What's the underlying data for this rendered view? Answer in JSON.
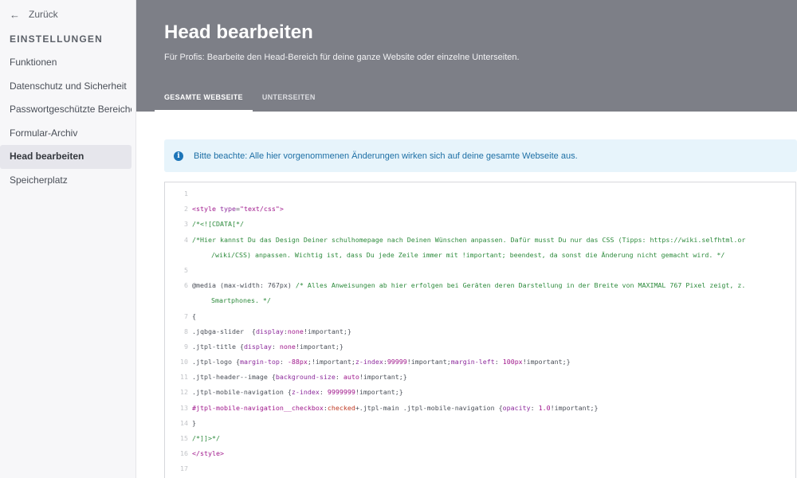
{
  "sidebar": {
    "back_label": "Zurück",
    "back_icon": "arrow-left-icon",
    "section_title": "EINSTELLUNGEN",
    "items": [
      {
        "label": "Funktionen",
        "active": false
      },
      {
        "label": "Datenschutz und Sicherheit",
        "active": false
      },
      {
        "label": "Passwortgeschützte Bereiche",
        "active": false
      },
      {
        "label": "Formular-Archiv",
        "active": false
      },
      {
        "label": "Head bearbeiten",
        "active": true
      },
      {
        "label": "Speicherplatz",
        "active": false
      }
    ]
  },
  "header": {
    "title": "Head bearbeiten",
    "subtitle": "Für Profis: Bearbeite den Head-Bereich für deine ganze Website oder einzelne Unterseiten.",
    "tabs": [
      {
        "label": "GESAMTE WEBSEITE",
        "active": true
      },
      {
        "label": "UNTERSEITEN",
        "active": false
      }
    ]
  },
  "notice": {
    "icon": "info-icon",
    "text": "Bitte beachte: Alle hier vorgenommenen Änderungen wirken sich auf deine gesamte Webseite aus."
  },
  "editor": {
    "lines": [
      {
        "n": "1",
        "tokens": []
      },
      {
        "n": "2",
        "tokens": [
          [
            "tag",
            "<style "
          ],
          [
            "prop",
            "type"
          ],
          [
            "def",
            "="
          ],
          [
            "str",
            "\"text/css\""
          ],
          [
            "tag",
            ">"
          ]
        ]
      },
      {
        "n": "3",
        "tokens": [
          [
            "com",
            "/*<![CDATA[*/"
          ]
        ]
      },
      {
        "n": "4",
        "tokens": [
          [
            "com",
            "/*Hier kannst Du das Design Deiner schulhomepage nach Deinen Wünschen anpassen. Dafür musst Du nur das CSS (Tipps: https://wiki.selfhtml.or"
          ]
        ]
      },
      {
        "n": "",
        "indent": true,
        "tokens": [
          [
            "com",
            "/wiki/CSS) anpassen. Wichtig ist, dass Du jede Zeile immer mit !important; beendest, da sonst die Änderung nicht gemacht wird. */"
          ]
        ]
      },
      {
        "n": "5",
        "tokens": []
      },
      {
        "n": "6",
        "tokens": [
          [
            "def",
            "@media (max-width: 767px) "
          ],
          [
            "com",
            "/* Alles Anweisungen ab hier erfolgen bei Geräten deren Darstellung in der Breite von MAXIMAL 767 Pixel zeigt, z."
          ]
        ]
      },
      {
        "n": "",
        "indent": true,
        "tokens": [
          [
            "com",
            "Smartphones. */"
          ]
        ]
      },
      {
        "n": "7",
        "tokens": [
          [
            "def",
            "{"
          ]
        ]
      },
      {
        "n": "8",
        "tokens": [
          [
            "def",
            ".jqbga-slider  {"
          ],
          [
            "prop",
            "display"
          ],
          [
            "def",
            ":"
          ],
          [
            "id",
            "none"
          ],
          [
            "def",
            "!important;}"
          ]
        ]
      },
      {
        "n": "9",
        "tokens": [
          [
            "def",
            ".jtpl-title {"
          ],
          [
            "prop",
            "display"
          ],
          [
            "def",
            ": "
          ],
          [
            "id",
            "none"
          ],
          [
            "def",
            "!important;}"
          ]
        ]
      },
      {
        "n": "10",
        "tokens": [
          [
            "def",
            ".jtpl-logo {"
          ],
          [
            "prop",
            "margin-top"
          ],
          [
            "def",
            ": "
          ],
          [
            "id",
            "-88px"
          ],
          [
            "def",
            ";!important;"
          ],
          [
            "prop",
            "z-index"
          ],
          [
            "def",
            ":"
          ],
          [
            "id",
            "99999"
          ],
          [
            "def",
            "!important;"
          ],
          [
            "prop",
            "margin-left"
          ],
          [
            "def",
            ": "
          ],
          [
            "id",
            "100px"
          ],
          [
            "def",
            "!important;}"
          ]
        ]
      },
      {
        "n": "11",
        "tokens": [
          [
            "def",
            ".jtpl-header--image {"
          ],
          [
            "prop",
            "background-size"
          ],
          [
            "def",
            ": "
          ],
          [
            "id",
            "auto"
          ],
          [
            "def",
            "!important;}"
          ]
        ]
      },
      {
        "n": "12",
        "tokens": [
          [
            "def",
            ".jtpl-mobile-navigation {"
          ],
          [
            "prop",
            "z-index"
          ],
          [
            "def",
            ": "
          ],
          [
            "id",
            "9999999"
          ],
          [
            "def",
            "!important;}"
          ]
        ]
      },
      {
        "n": "13",
        "tokens": [
          [
            "id",
            "#jtpl-mobile-navigation__checkbox"
          ],
          [
            "def",
            ":"
          ],
          [
            "kw",
            "checked"
          ],
          [
            "def",
            "+.jtpl-main .jtpl-mobile-navigation {"
          ],
          [
            "prop",
            "opacity"
          ],
          [
            "def",
            ": "
          ],
          [
            "id",
            "1.0"
          ],
          [
            "def",
            "!important;}"
          ]
        ]
      },
      {
        "n": "14",
        "tokens": [
          [
            "def",
            "}"
          ]
        ]
      },
      {
        "n": "15",
        "tokens": [
          [
            "com",
            "/*]]>*/"
          ]
        ]
      },
      {
        "n": "16",
        "tokens": [
          [
            "tag",
            "</style>"
          ]
        ]
      },
      {
        "n": "17",
        "tokens": []
      }
    ]
  },
  "colors": {
    "header_bg": "#7d7f87",
    "sidebar_bg": "#f7f7f9",
    "notice_bg": "#e7f4fb",
    "accent_blue": "#1d75b8"
  }
}
